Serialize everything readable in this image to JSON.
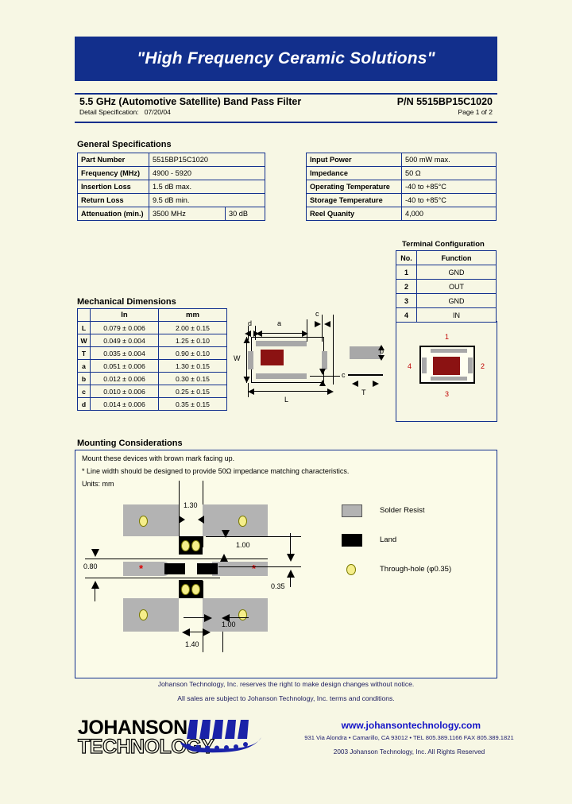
{
  "banner": {
    "tagline": "\"High Frequency Ceramic Solutions\""
  },
  "title": {
    "product": "5.5 GHz (Automotive Satellite) Band Pass Filter",
    "part_number": "P/N 5515BP15C1020",
    "detail_spec_label": "Detail Specification:",
    "detail_spec_date": "07/20/04",
    "page": "Page 1 of 2"
  },
  "general_specifications": {
    "heading": "General Specifications",
    "rows": [
      {
        "label": "Part Number",
        "value": "5515BP15C1020"
      },
      {
        "label": "Frequency (MHz)",
        "value": "4900 - 5920"
      },
      {
        "label": "Insertion Loss",
        "value": "1.5 dB max."
      },
      {
        "label": "Return Loss",
        "value": "9.5 dB min."
      }
    ],
    "attenuation": {
      "label": "Attenuation (min.)",
      "freq": "3500 MHz",
      "value": "30 dB"
    }
  },
  "electrical_specifications": {
    "rows": [
      {
        "label": "Input Power",
        "value": "500 mW max."
      },
      {
        "label": "Impedance",
        "value": "50 Ω"
      },
      {
        "label": "Operating Temperature",
        "value": "-40 to +85°C"
      },
      {
        "label": "Storage Temperature",
        "value": "-40 to +85°C"
      },
      {
        "label": "Reel Quanity",
        "value": "4,000"
      }
    ]
  },
  "terminal_configuration": {
    "heading": "Terminal Configuration",
    "headers": {
      "no": "No.",
      "function": "Function"
    },
    "rows": [
      {
        "no": "1",
        "function": "GND"
      },
      {
        "no": "2",
        "function": "OUT"
      },
      {
        "no": "3",
        "function": "GND"
      },
      {
        "no": "4",
        "function": "IN"
      }
    ],
    "diagram_numbers": {
      "top": "1",
      "right": "2",
      "bottom": "3",
      "left": "4"
    }
  },
  "mechanical_dimensions": {
    "heading": "Mechanical Dimensions",
    "headers": {
      "symbol": "",
      "in": "In",
      "mm": "mm"
    },
    "rows": [
      {
        "symbol": "L",
        "in": "0.079  ±  0.006",
        "mm": "2.00  ±  0.15"
      },
      {
        "symbol": "W",
        "in": "0.049  ±  0.004",
        "mm": "1.25  ±  0.10"
      },
      {
        "symbol": "T",
        "in": "0.035  ±  0.004",
        "mm": "0.90  ±  0.10"
      },
      {
        "symbol": "a",
        "in": "0.051  ±  0.006",
        "mm": "1.30  ±  0.15"
      },
      {
        "symbol": "b",
        "in": "0.012  ±  0.006",
        "mm": "0.30  ±  0.15"
      },
      {
        "symbol": "c",
        "in": "0.010  ±  0.006",
        "mm": "0.25  ±  0.15"
      },
      {
        "symbol": "d",
        "in": "0.014  ±  0.006",
        "mm": "0.35  ±  0.15"
      }
    ],
    "drawing_labels": {
      "d": "d",
      "a": "a",
      "c_top": "c",
      "c_right": "c",
      "w": "W",
      "l": "L",
      "b": "b",
      "t": "T"
    }
  },
  "mounting": {
    "heading": "Mounting Considerations",
    "note1": "Mount these devices with brown mark facing up.",
    "note2": "* Line width should be designed to provide 50Ω impedance matching characteristics.",
    "note3": "Units: mm",
    "dimensions": {
      "top_gap": "1.30",
      "right_upper": "1.00",
      "left": "0.80",
      "right_lower": "0.35",
      "bottom_inner": "1.00",
      "bottom_outer": "1.40"
    },
    "legend": [
      {
        "swatch": "solder-resist",
        "label": "Solder Resist"
      },
      {
        "swatch": "land",
        "label": "Land"
      },
      {
        "swatch": "through-hole",
        "label": "Through-hole (φ0.35)"
      }
    ],
    "star_marks": {
      "left": "*",
      "right": "*"
    }
  },
  "disclaimers": {
    "line1": "Johanson Technology, Inc. reserves the right to make design changes without notice.",
    "line2": "All sales are subject to Johanson Technology, Inc. terms and conditions."
  },
  "footer": {
    "logo_line1": "JOHANSON",
    "logo_line2": "TECHNOLOGY",
    "website": "www.johansontechnology.com",
    "address": "931 Via Alondra • Camarillo, CA 93012 • TEL 805.389.1166 FAX 805.389.1821",
    "copyright": "2003 Johanson Technology, Inc.  All Rights Reserved"
  },
  "colors": {
    "brand_blue": "#122f8c",
    "page_bg": "#f7f7e4",
    "brown_mark": "#8b1212",
    "solder_resist": "#b3b3b3",
    "through_hole": "#f5ee8a",
    "star_red": "#dd0000"
  }
}
